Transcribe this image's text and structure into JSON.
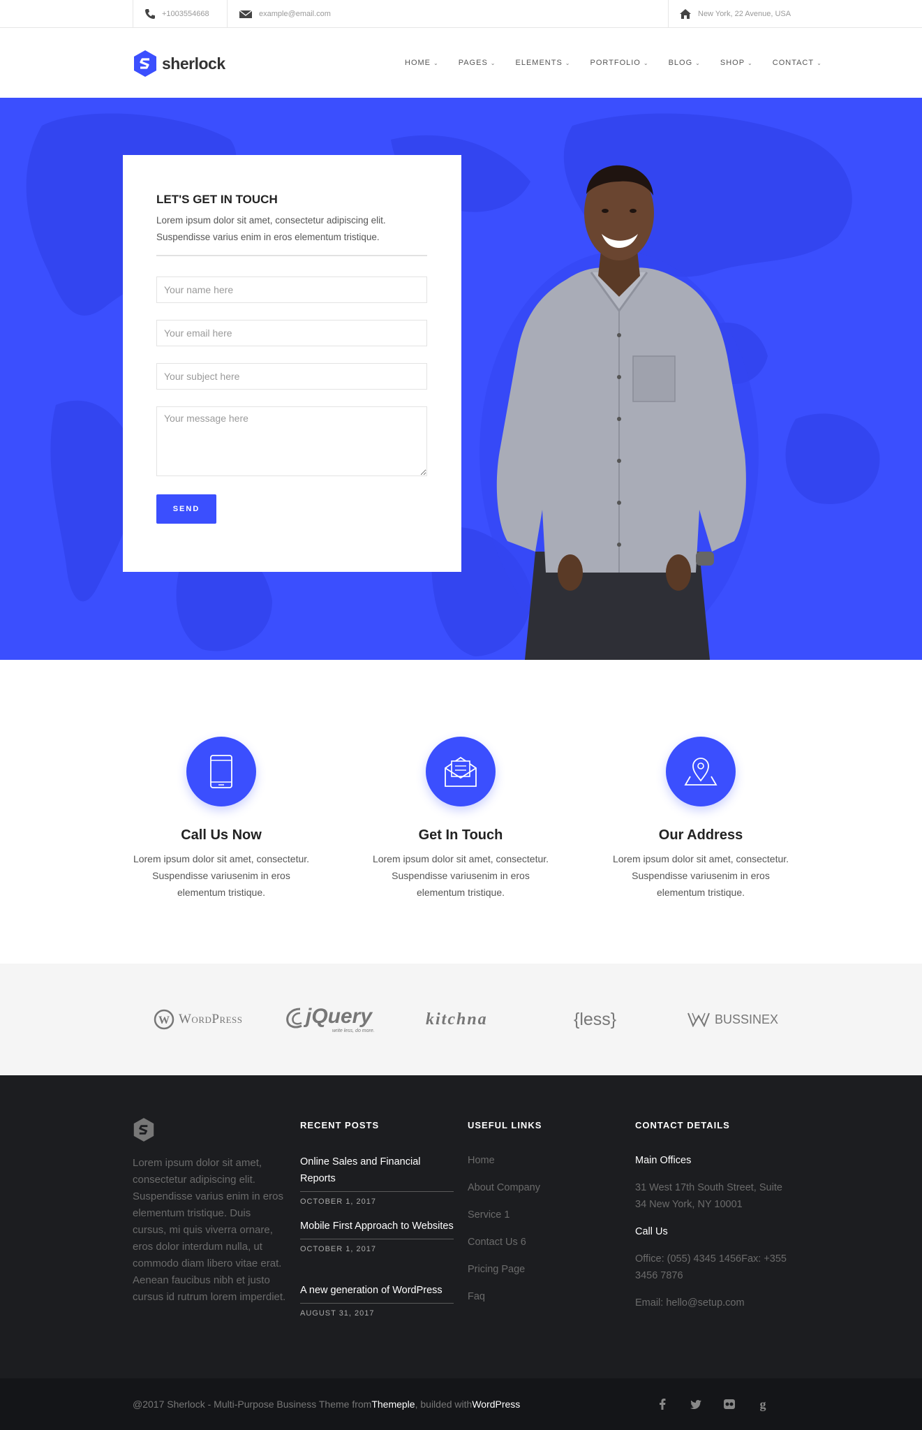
{
  "topbar": {
    "phone": "+1003554668",
    "email": "example@email.com",
    "address": "New York, 22 Avenue, USA"
  },
  "header": {
    "logo_text": "sherlock",
    "nav": [
      "HOME",
      "PAGES",
      "ELEMENTS",
      "PORTFOLIO",
      "BLOG",
      "SHOP",
      "CONTACT"
    ]
  },
  "contact_form": {
    "title": "LET'S GET IN TOUCH",
    "description": "Lorem ipsum dolor sit amet, consectetur adipiscing elit. Suspendisse varius enim in eros elementum tristique.",
    "name_placeholder": "Your name here",
    "email_placeholder": "Your email here",
    "subject_placeholder": "Your subject here",
    "message_placeholder": "Your message here",
    "send_label": "SEND"
  },
  "features": [
    {
      "title": "Call Us Now",
      "text": "Lorem ipsum dolor sit amet, consectetur. Suspendisse variusenim in eros elementum tristique."
    },
    {
      "title": "Get In Touch",
      "text": "Lorem ipsum dolor sit amet, consectetur. Suspendisse variusenim in eros elementum tristique."
    },
    {
      "title": "Our Address",
      "text": "Lorem ipsum dolor sit amet, consectetur. Suspendisse variusenim in eros elementum tristique."
    }
  ],
  "clients": {
    "wordpress": "WordPress",
    "jquery": "jQuery",
    "jquery_tagline": "write less, do more.",
    "kitchna": "kitchna",
    "less": "{less}",
    "bussinex": "BUSSINEX"
  },
  "footer": {
    "about": "Lorem ipsum dolor sit amet, consectetur adipiscing elit. Suspendisse varius enim in eros elementum tristique. Duis cursus, mi quis viverra ornare, eros dolor interdum nulla, ut commodo diam libero vitae erat. Aenean faucibus nibh et justo cursus id rutrum lorem imperdiet.",
    "recent_posts_title": "RECENT POSTS",
    "posts": [
      {
        "title": "Online Sales and Financial Reports",
        "date": "OCTOBER 1, 2017"
      },
      {
        "title": "Mobile First Approach to Websites",
        "date": "OCTOBER 1, 2017"
      },
      {
        "title": "A new generation of WordPress",
        "date": "AUGUST 31, 2017"
      }
    ],
    "useful_links_title": "USEFUL LINKS",
    "links": [
      "Home",
      "About Company",
      "Service 1",
      "Contact Us 6",
      "Pricing Page",
      "Faq"
    ],
    "contact_title": "CONTACT DETAILS",
    "main_offices_label": "Main Offices",
    "address": "31 West 17th South Street, Suite 34 New York, NY 10001",
    "call_us_label": "Call Us",
    "phones": "Office: (055) 4345 1456Fax: +355 3456 7876",
    "email": "Email: hello@setup.com"
  },
  "bottombar": {
    "copyright_prefix": "@2017 Sherlock - Multi-Purpose Business Theme from ",
    "themeple": "Themeple",
    "middle": ", builded with ",
    "wordpress": "WordPress",
    "socials": [
      "facebook-icon",
      "twitter-icon",
      "flickr-icon",
      "google-plus-icon"
    ]
  },
  "colors": {
    "accent": "#3b4ffe",
    "footer_bg": "#1c1d20",
    "bottombar_bg": "#141518",
    "clients_bg": "#f5f5f5"
  }
}
